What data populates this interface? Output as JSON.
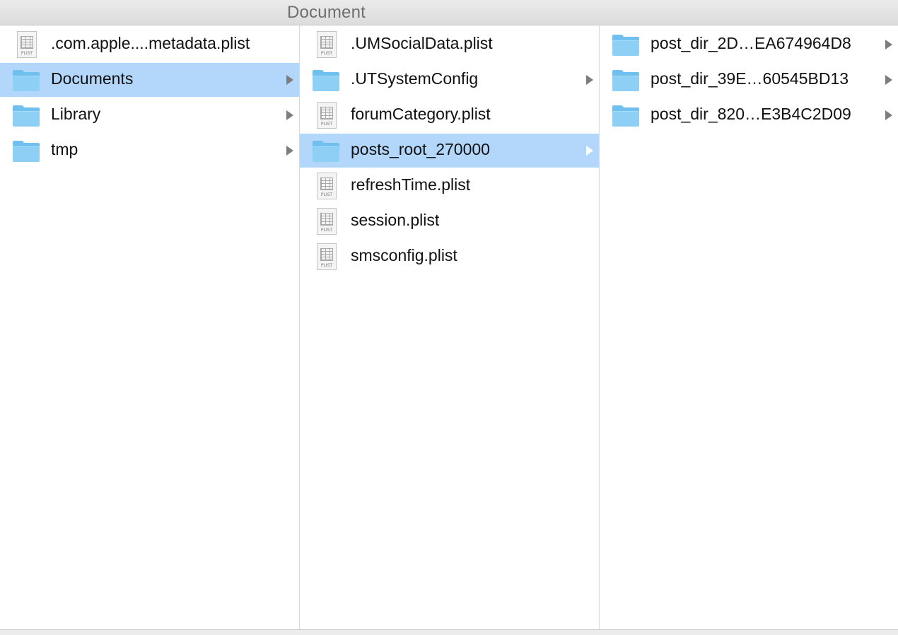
{
  "window": {
    "title": "Document"
  },
  "columns": [
    {
      "items": [
        {
          "label": ".com.apple....metadata.plist",
          "kind": "file-plist",
          "file_type": "PLIST",
          "has_children": false,
          "selected": false
        },
        {
          "label": "Documents",
          "kind": "folder",
          "has_children": true,
          "selected": true
        },
        {
          "label": "Library",
          "kind": "folder",
          "has_children": true,
          "selected": false
        },
        {
          "label": "tmp",
          "kind": "folder",
          "has_children": true,
          "selected": false
        }
      ]
    },
    {
      "items": [
        {
          "label": ".UMSocialData.plist",
          "kind": "file-plist",
          "file_type": "PLIST",
          "has_children": false,
          "selected": false
        },
        {
          "label": ".UTSystemConfig",
          "kind": "folder",
          "has_children": true,
          "selected": false
        },
        {
          "label": "forumCategory.plist",
          "kind": "file-plist",
          "file_type": "PLIST",
          "has_children": false,
          "selected": false
        },
        {
          "label": "posts_root_270000",
          "kind": "folder",
          "has_children": true,
          "selected": true
        },
        {
          "label": "refreshTime.plist",
          "kind": "file-plist",
          "file_type": "PLIST",
          "has_children": false,
          "selected": false
        },
        {
          "label": "session.plist",
          "kind": "file-plist",
          "file_type": "PLIST",
          "has_children": false,
          "selected": false
        },
        {
          "label": "smsconfig.plist",
          "kind": "file-plist",
          "file_type": "PLIST",
          "has_children": false,
          "selected": false
        }
      ]
    },
    {
      "items": [
        {
          "label": "post_dir_2D…EA674964D8",
          "kind": "folder",
          "has_children": true,
          "selected": false
        },
        {
          "label": "post_dir_39E…60545BD13",
          "kind": "folder",
          "has_children": true,
          "selected": false
        },
        {
          "label": "post_dir_820…E3B4C2D09",
          "kind": "folder",
          "has_children": true,
          "selected": false
        }
      ]
    }
  ],
  "colors": {
    "selection": "#b3d7fb",
    "folder": "#8ed0f5",
    "disclosure_arrow": "#7d7d7d"
  },
  "icons": {
    "folder": "folder-icon",
    "file-plist": "plist-file-icon",
    "disclosure": "chevron-right-icon"
  }
}
